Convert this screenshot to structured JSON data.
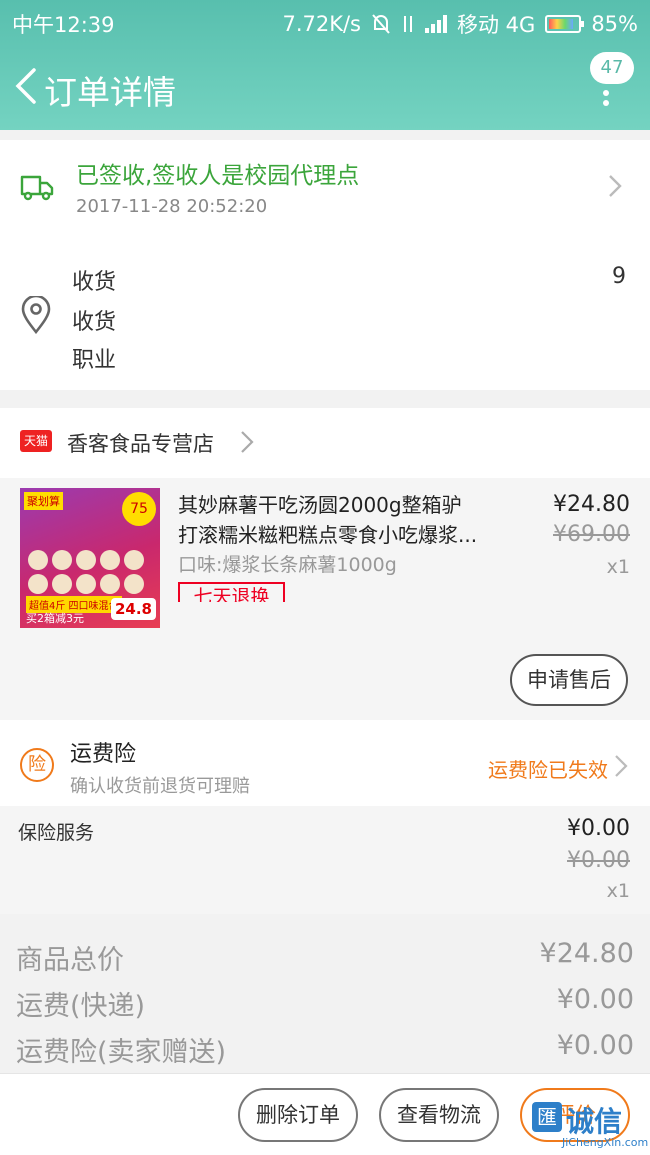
{
  "status_bar": {
    "time": "中午12:39",
    "net_speed": "7.72K/s",
    "carrier": "移动 4G",
    "battery": "85%"
  },
  "header": {
    "title": "订单详情",
    "message_count": "47"
  },
  "logistics": {
    "status": "已签收,签收人是校园代理点",
    "time": "2017-11-28 20:52:20"
  },
  "address": {
    "line1": "收货",
    "line1_tail": "9",
    "line2": "收货",
    "line3": "职业"
  },
  "shop": {
    "badge": "天猫",
    "name": "香客食品专营店"
  },
  "item": {
    "title_line1": "其妙麻薯干吃汤圆2000g整箱驴",
    "title_line2": "打滚糯米糍粑糕点零食小吃爆浆...",
    "spec": "口味:爆浆长条麻薯1000g",
    "tag": "七天退换",
    "price": "¥24.80",
    "original_price": "¥69.00",
    "quantity": "x1",
    "after_sale_button": "申请售后",
    "image_texts": {
      "promo": "聚划算",
      "discount": "75",
      "label1": "超值4斤 四口味混合",
      "label2": "买2箱减3元",
      "price_tag": "24.8"
    }
  },
  "insurance": {
    "icon": "险",
    "title": "运费险",
    "subtitle": "确认收货前退货可理赔",
    "status": "运费险已失效"
  },
  "service": {
    "name": "保险服务",
    "price": "¥0.00",
    "original_price": "¥0.00",
    "quantity": "x1"
  },
  "summary": [
    {
      "label": "商品总价",
      "value": "¥24.80"
    },
    {
      "label": "运费(快递)",
      "value": "¥0.00"
    },
    {
      "label": "运费险(卖家赠送)",
      "value": "¥0.00"
    }
  ],
  "bottom_bar": {
    "delete_label": "删除订单",
    "logistics_label": "查看物流",
    "review_label": "评价"
  },
  "watermark": {
    "glyph": "匯",
    "text": "诚信",
    "url": "JiChengXin.com"
  },
  "colors": {
    "header": "#5ab9a8",
    "status_green": "#3ba53b",
    "accent_orange": "#f07a1b"
  }
}
